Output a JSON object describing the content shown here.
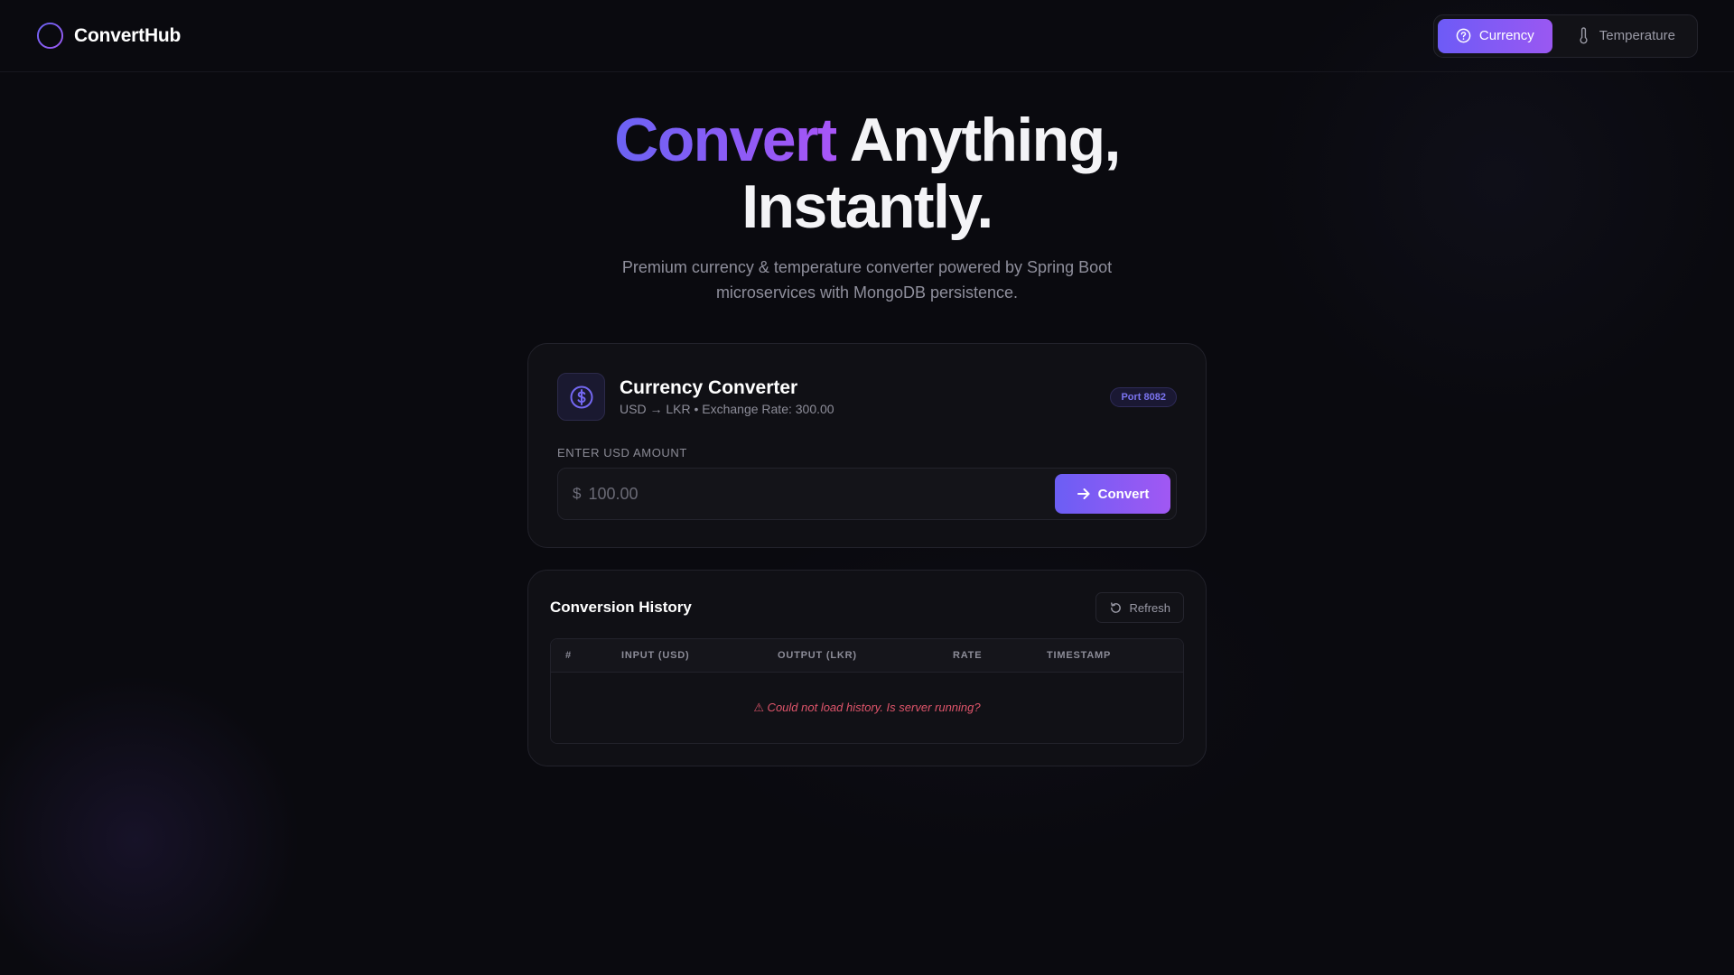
{
  "header": {
    "brand": "ConvertHub",
    "modes": [
      {
        "label": "Currency",
        "icon": "currency-icon",
        "active": true
      },
      {
        "label": "Temperature",
        "icon": "thermometer-icon",
        "active": false
      }
    ]
  },
  "hero": {
    "title_accent": "Convert",
    "title_rest_1": " Anything,",
    "title_rest_2": "Instantly.",
    "subtitle": "Premium currency & temperature converter powered by Spring Boot microservices with MongoDB persistence."
  },
  "converter": {
    "icon": "dollar-icon",
    "title": "Currency Converter",
    "meta": "USD → LKR • Exchange Rate: 300.00",
    "port_badge": "Port 8082",
    "field_label": "Enter USD Amount",
    "currency_sign": "$",
    "placeholder": "100.00",
    "value": "",
    "button_label": "Convert"
  },
  "history": {
    "title": "Conversion History",
    "refresh_label": "Refresh",
    "columns": [
      "#",
      "Input (USD)",
      "Output (LKR)",
      "Rate",
      "Timestamp"
    ],
    "error": "⚠ Could not load history. Is server running?"
  },
  "colors": {
    "accent_start": "#6b63f4",
    "accent_end": "#a855f7",
    "error": "#e0556b",
    "background": "#0a0a0f"
  }
}
